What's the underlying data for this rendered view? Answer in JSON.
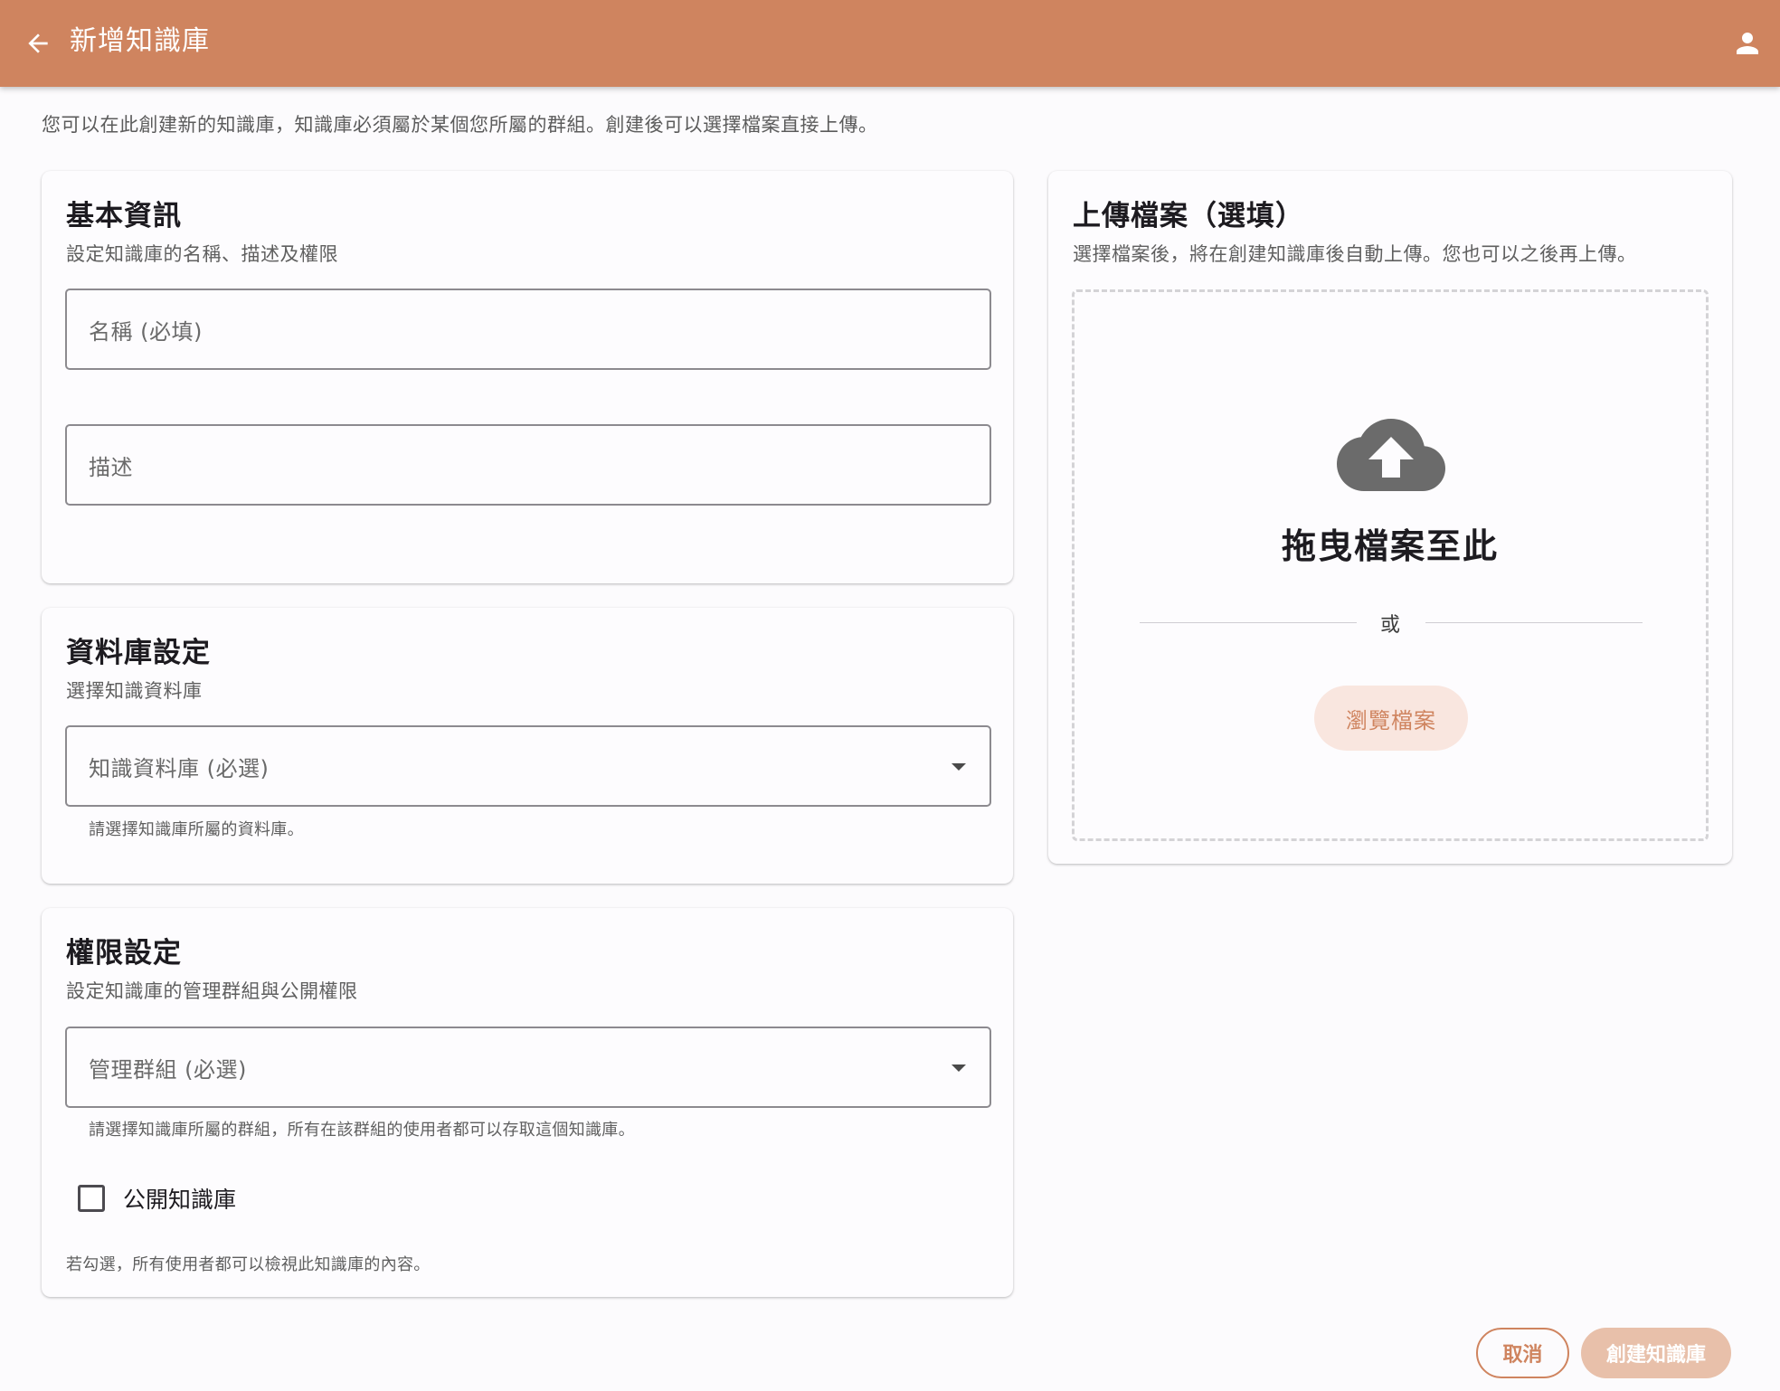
{
  "app_bar": {
    "title": "新增知識庫",
    "color": "#cf845f"
  },
  "intro": "您可以在此創建新的知識庫，知識庫必須屬於某個您所屬的群組。創建後可以選擇檔案直接上傳。",
  "basic_info": {
    "title": "基本資訊",
    "subtitle": "設定知識庫的名稱、描述及權限",
    "name_placeholder": "名稱 (必填)",
    "description_placeholder": "描述"
  },
  "database_settings": {
    "title": "資料庫設定",
    "subtitle": "選擇知識資料庫",
    "select_label": "知識資料庫 (必選)",
    "helper": "請選擇知識庫所屬的資料庫。"
  },
  "permission_settings": {
    "title": "權限設定",
    "subtitle": "設定知識庫的管理群組與公開權限",
    "select_label": "管理群組 (必選)",
    "helper": "請選擇知識庫所屬的群組，所有在該群組的使用者都可以存取這個知識庫。",
    "checkbox_label": "公開知識庫",
    "checkbox_checked": false,
    "checkbox_helper": "若勾選，所有使用者都可以檢視此知識庫的內容。"
  },
  "upload": {
    "title": "上傳檔案（選填）",
    "subtitle": "選擇檔案後，將在創建知識庫後自動上傳。您也可以之後再上傳。",
    "drop_title": "拖曳檔案至此",
    "or_text": "或",
    "browse_label": "瀏覽檔案",
    "icon": "cloud-upload-icon"
  },
  "actions": {
    "cancel_label": "取消",
    "create_label": "創建知識庫"
  }
}
